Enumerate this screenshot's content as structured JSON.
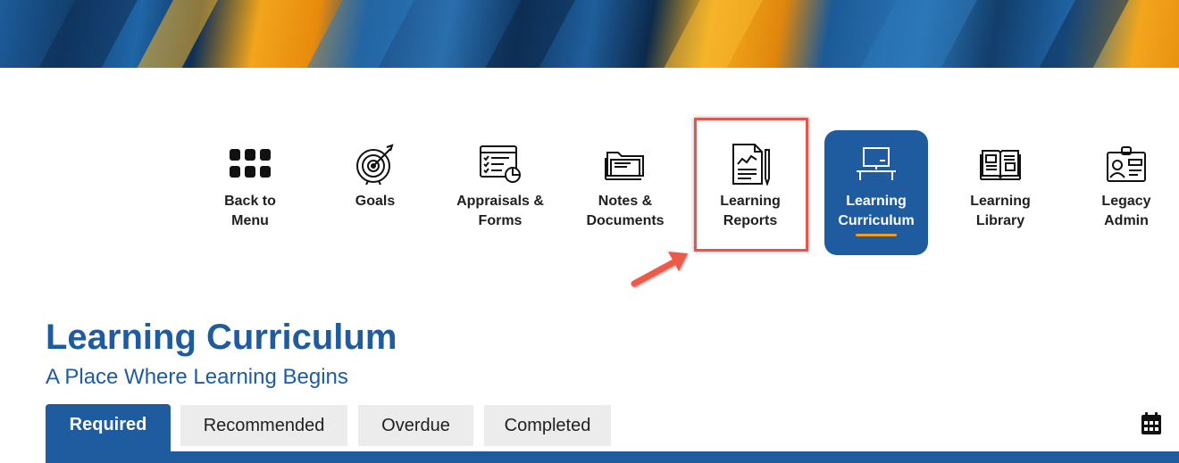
{
  "nav": {
    "items": [
      {
        "label": "Back to\nMenu",
        "icon": "grid-menu-icon"
      },
      {
        "label": "Goals",
        "icon": "target-icon"
      },
      {
        "label": "Appraisals &\nForms",
        "icon": "form-checklist-icon"
      },
      {
        "label": "Notes &\nDocuments",
        "icon": "folder-documents-icon"
      },
      {
        "label": "Learning\nReports",
        "icon": "report-chart-icon"
      },
      {
        "label": "Learning\nCurriculum",
        "icon": "classroom-board-icon",
        "active": true
      },
      {
        "label": "Learning\nLibrary",
        "icon": "open-book-icon"
      },
      {
        "label": "Legacy\nAdmin",
        "icon": "id-badge-icon"
      }
    ]
  },
  "page": {
    "title": "Learning Curriculum",
    "subtitle": "A Place Where Learning Begins"
  },
  "tabs": [
    {
      "label": "Required",
      "active": true
    },
    {
      "label": "Recommended"
    },
    {
      "label": "Overdue"
    },
    {
      "label": "Completed"
    }
  ],
  "toolbar": {
    "calendar_icon": "calendar-icon"
  },
  "colors": {
    "brand_blue": "#1e5c9f",
    "accent_orange": "#f39c1f",
    "highlight_red": "#e8534a",
    "tab_gray": "#ececec"
  }
}
